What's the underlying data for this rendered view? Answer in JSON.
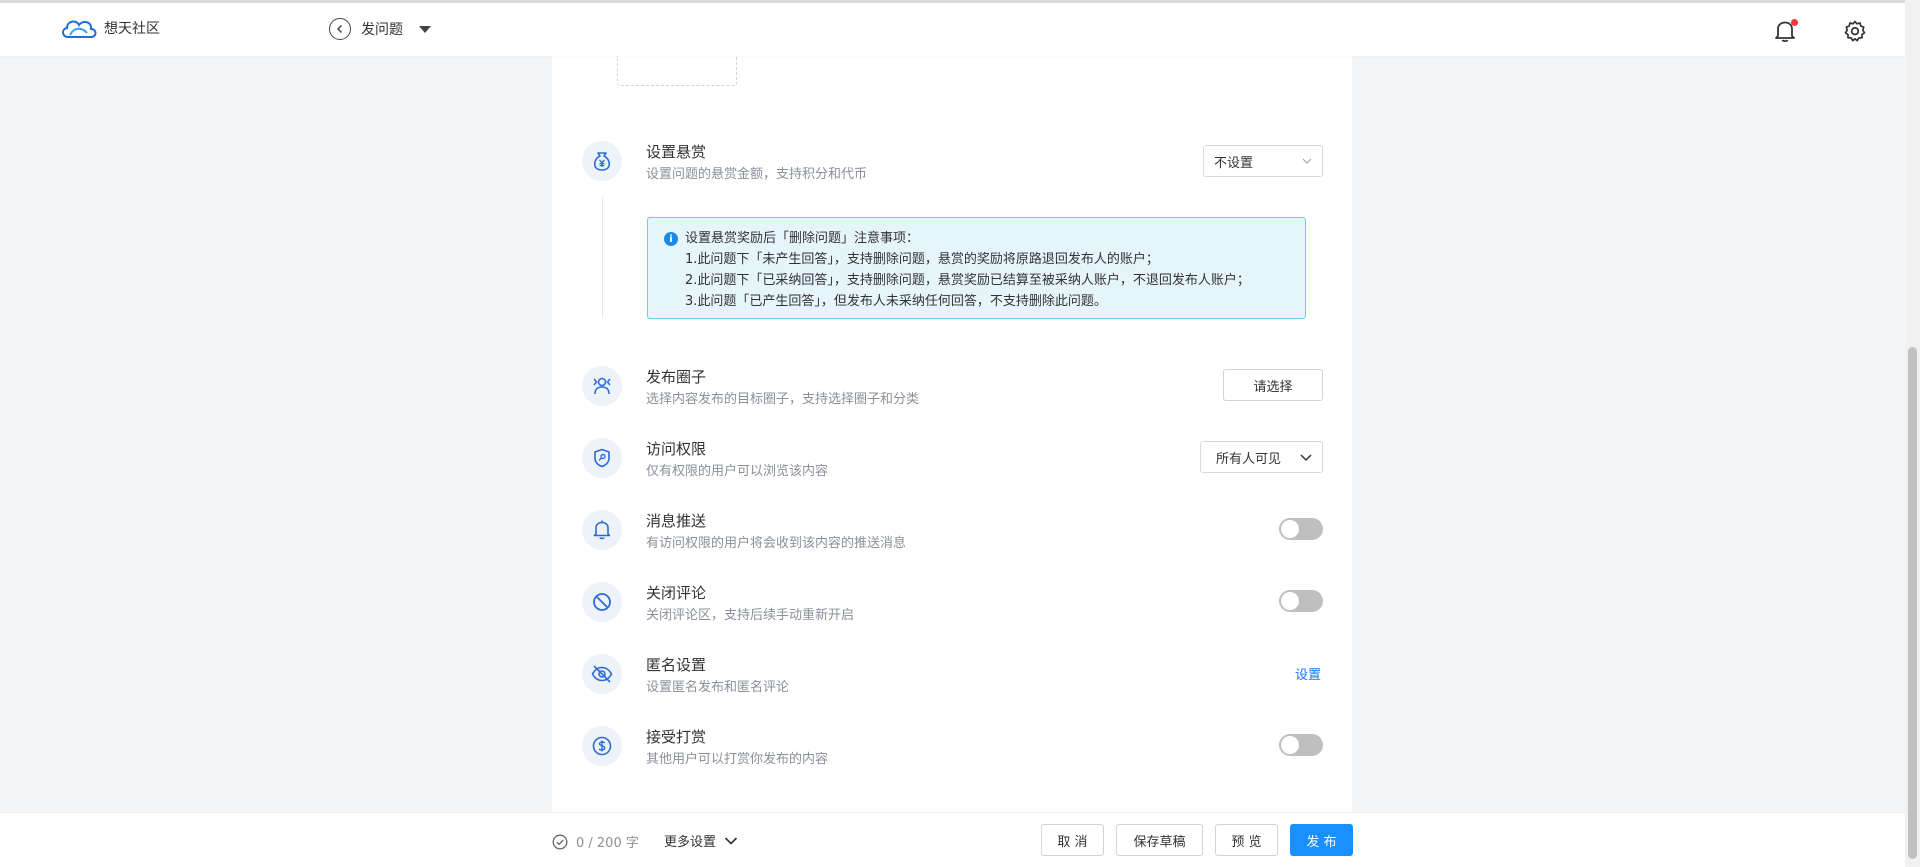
{
  "header": {
    "logo_text": "想天社区",
    "page_title": "发问题"
  },
  "reward": {
    "title": "设置悬赏",
    "desc": "设置问题的悬赏金额，支持积分和代币",
    "select_value": "不设置",
    "notice_title": "设置悬赏奖励后「删除问题」注意事项：",
    "notice_lines": [
      "1.此问题下「未产生回答」，支持删除问题，悬赏的奖励将原路退回发布人的账户；",
      "2.此问题下「已采纳回答」，支持删除问题，悬赏奖励已结算至被采纳人账户，不退回发布人账户；",
      "3.此问题「已产生回答」，但发布人未采纳任何回答，不支持删除此问题。"
    ]
  },
  "circle": {
    "title": "发布圈子",
    "desc": "选择内容发布的目标圈子，支持选择圈子和分类",
    "button_label": "请选择"
  },
  "access": {
    "title": "访问权限",
    "desc": "仅有权限的用户可以浏览该内容",
    "select_value": "所有人可见"
  },
  "push": {
    "title": "消息推送",
    "desc": "有访问权限的用户将会收到该内容的推送消息",
    "enabled": false
  },
  "comments": {
    "title": "关闭评论",
    "desc": "关闭评论区，支持后续手动重新开启",
    "enabled": false
  },
  "anonymous": {
    "title": "匿名设置",
    "desc": "设置匿名发布和匿名评论",
    "link_label": "设置"
  },
  "tipping": {
    "title": "接受打赏",
    "desc": "其他用户可以打赏你发布的内容",
    "enabled": false
  },
  "footer": {
    "word_count": "0 / 200 字",
    "more_settings": "更多设置",
    "cancel": "取 消",
    "save_draft": "保存草稿",
    "preview": "预 览",
    "publish": "发 布"
  },
  "colors": {
    "accent": "#1890ff",
    "link": "#1677ff",
    "notice_bg": "#e6f4fb",
    "notice_border": "#7cc7ef",
    "icon_bg": "#eef3fa",
    "icon_fg": "#2b6cd8",
    "notification_dot": "#f5363c"
  }
}
